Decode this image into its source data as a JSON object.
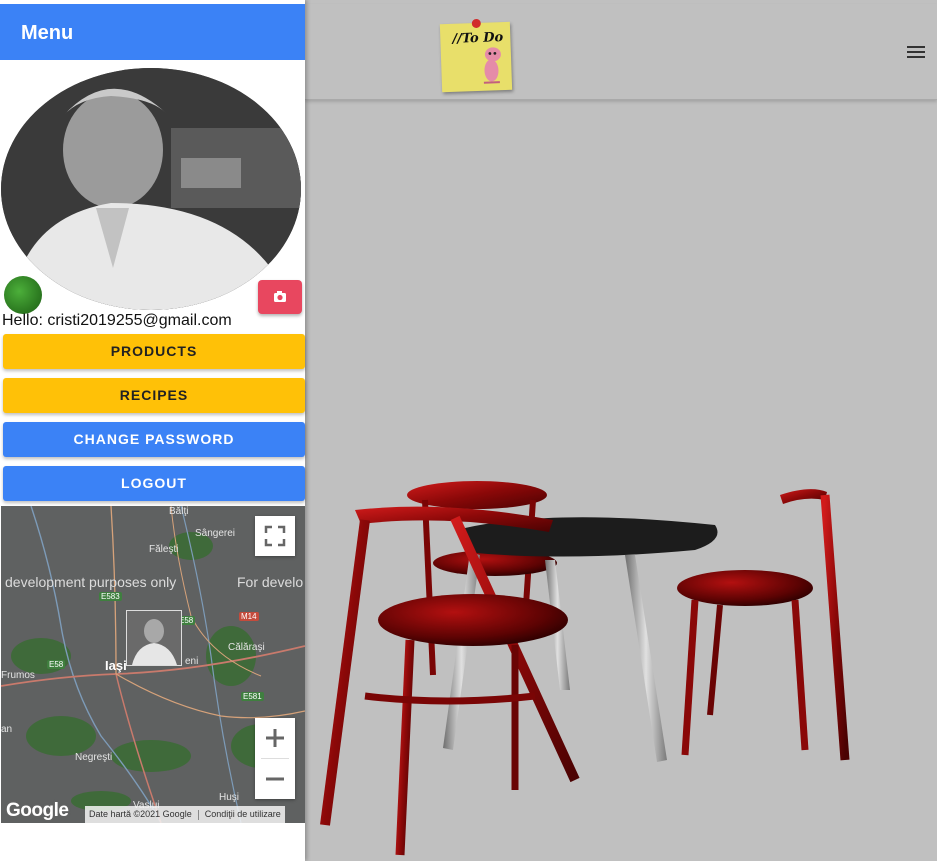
{
  "main": {
    "logo_text": "//To Do",
    "hamburger_icon": "hamburger-menu-icon"
  },
  "sidebar": {
    "title": "Menu",
    "hello_text": "Hello: cristi2019255@gmail.com",
    "camera_icon": "camera-icon",
    "buttons": {
      "products": "PRODUCTS",
      "recipes": "RECIPES",
      "change_password": "CHANGE PASSWORD",
      "logout": "LOGOUT"
    },
    "colors": {
      "header": "#3b82f6",
      "yellow_button": "#ffc107",
      "blue_button": "#3b82f6",
      "camera_button": "#e8475f"
    }
  },
  "map": {
    "watermark_1": "development purposes only",
    "watermark_2": "For develo",
    "cities": {
      "balti": "Bălţi",
      "falesti": "Făleşti",
      "sangerei": "Sângerei",
      "iasi": "Iaşi",
      "calarasi": "Călăraşi",
      "frumos": "Frumos",
      "negresti": "Negreşti",
      "husi": "Huşi",
      "vaslui": "Vaslui",
      "an": "an",
      "eni": "eni"
    },
    "roads": {
      "e583": "E583",
      "e58_a": "E58",
      "e58_b": "E58",
      "m14": "M14",
      "e581": "E581"
    },
    "attribution": "Date hartă ©2021 Google",
    "terms": "Condiţii de utilizare",
    "google_logo": "Google",
    "fullscreen_icon": "fullscreen-icon",
    "zoom_in_icon": "plus-icon",
    "zoom_out_icon": "minus-icon"
  }
}
